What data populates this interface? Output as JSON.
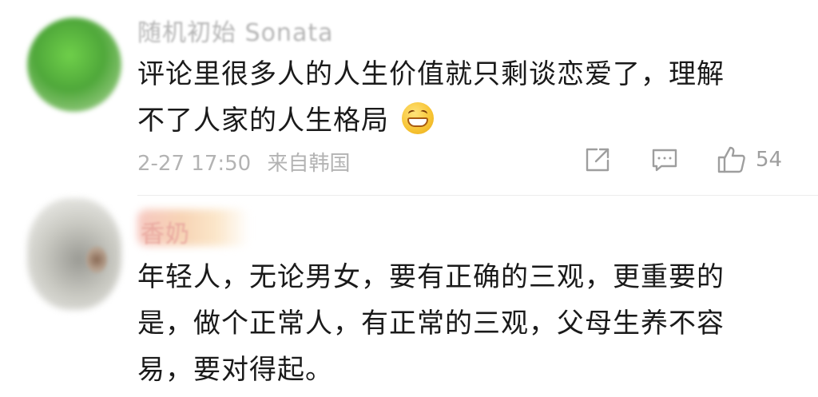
{
  "comments": [
    {
      "username": "随机初始 Sonata",
      "text_lines": [
        "评论里很多人的人生价值就只剩谈恋爱了，理解",
        "不了人家的人生格局"
      ],
      "emoji": "grin-emoji",
      "timestamp": "2-27 17:50",
      "source": "来自韩国",
      "likes": "54",
      "icons": [
        "share-icon",
        "comment-icon",
        "like-icon"
      ]
    },
    {
      "username": "香奶",
      "text_lines": [
        "年轻人，无论男女，要有正确的三观，更重要的",
        "是，做个正常人，有正常的三观，父母生养不容",
        "易，要对得起。"
      ]
    }
  ]
}
